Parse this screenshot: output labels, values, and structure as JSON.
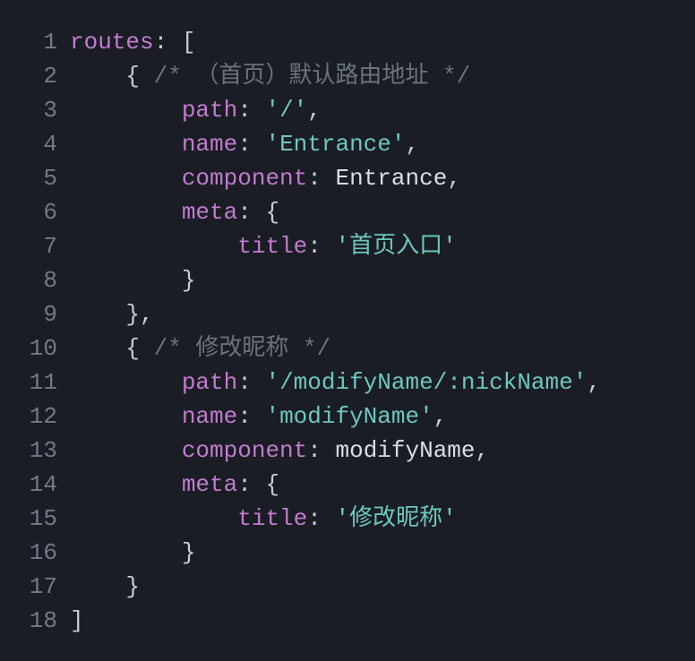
{
  "lines": [
    {
      "num": "1",
      "tokens": [
        {
          "cls": "t-key",
          "text": "routes"
        },
        {
          "cls": "t-plain",
          "text": ": ["
        }
      ]
    },
    {
      "num": "2",
      "tokens": [
        {
          "cls": "t-plain",
          "text": "    { "
        },
        {
          "cls": "t-comment",
          "text": "/* （首页）默认路由地址 */"
        }
      ]
    },
    {
      "num": "3",
      "tokens": [
        {
          "cls": "t-plain",
          "text": "        "
        },
        {
          "cls": "t-key",
          "text": "path"
        },
        {
          "cls": "t-plain",
          "text": ": "
        },
        {
          "cls": "t-string",
          "text": "'/'"
        },
        {
          "cls": "t-plain",
          "text": ","
        }
      ]
    },
    {
      "num": "4",
      "tokens": [
        {
          "cls": "t-plain",
          "text": "        "
        },
        {
          "cls": "t-key",
          "text": "name"
        },
        {
          "cls": "t-plain",
          "text": ": "
        },
        {
          "cls": "t-string",
          "text": "'Entrance'"
        },
        {
          "cls": "t-plain",
          "text": ","
        }
      ]
    },
    {
      "num": "5",
      "tokens": [
        {
          "cls": "t-plain",
          "text": "        "
        },
        {
          "cls": "t-key",
          "text": "component"
        },
        {
          "cls": "t-plain",
          "text": ": "
        },
        {
          "cls": "t-ident",
          "text": "Entrance"
        },
        {
          "cls": "t-plain",
          "text": ","
        }
      ]
    },
    {
      "num": "6",
      "tokens": [
        {
          "cls": "t-plain",
          "text": "        "
        },
        {
          "cls": "t-key",
          "text": "meta"
        },
        {
          "cls": "t-plain",
          "text": ": {"
        }
      ]
    },
    {
      "num": "7",
      "tokens": [
        {
          "cls": "t-plain",
          "text": "            "
        },
        {
          "cls": "t-key",
          "text": "title"
        },
        {
          "cls": "t-plain",
          "text": ": "
        },
        {
          "cls": "t-string",
          "text": "'首页入口'"
        }
      ]
    },
    {
      "num": "8",
      "tokens": [
        {
          "cls": "t-plain",
          "text": "        }"
        }
      ]
    },
    {
      "num": "9",
      "tokens": [
        {
          "cls": "t-plain",
          "text": "    },"
        }
      ]
    },
    {
      "num": "10",
      "tokens": [
        {
          "cls": "t-plain",
          "text": "    { "
        },
        {
          "cls": "t-comment",
          "text": "/* 修改昵称 */"
        }
      ]
    },
    {
      "num": "11",
      "tokens": [
        {
          "cls": "t-plain",
          "text": "        "
        },
        {
          "cls": "t-key",
          "text": "path"
        },
        {
          "cls": "t-plain",
          "text": ": "
        },
        {
          "cls": "t-string",
          "text": "'/modifyName/:nickName'"
        },
        {
          "cls": "t-plain",
          "text": ","
        }
      ]
    },
    {
      "num": "12",
      "tokens": [
        {
          "cls": "t-plain",
          "text": "        "
        },
        {
          "cls": "t-key",
          "text": "name"
        },
        {
          "cls": "t-plain",
          "text": ": "
        },
        {
          "cls": "t-string",
          "text": "'modifyName'"
        },
        {
          "cls": "t-plain",
          "text": ","
        }
      ]
    },
    {
      "num": "13",
      "tokens": [
        {
          "cls": "t-plain",
          "text": "        "
        },
        {
          "cls": "t-key",
          "text": "component"
        },
        {
          "cls": "t-plain",
          "text": ": "
        },
        {
          "cls": "t-ident",
          "text": "modifyName"
        },
        {
          "cls": "t-plain",
          "text": ","
        }
      ]
    },
    {
      "num": "14",
      "tokens": [
        {
          "cls": "t-plain",
          "text": "        "
        },
        {
          "cls": "t-key",
          "text": "meta"
        },
        {
          "cls": "t-plain",
          "text": ": {"
        }
      ]
    },
    {
      "num": "15",
      "tokens": [
        {
          "cls": "t-plain",
          "text": "            "
        },
        {
          "cls": "t-key",
          "text": "title"
        },
        {
          "cls": "t-plain",
          "text": ": "
        },
        {
          "cls": "t-string",
          "text": "'修改昵称'"
        }
      ]
    },
    {
      "num": "16",
      "tokens": [
        {
          "cls": "t-plain",
          "text": "        }"
        }
      ]
    },
    {
      "num": "17",
      "tokens": [
        {
          "cls": "t-plain",
          "text": "    }"
        }
      ]
    },
    {
      "num": "18",
      "tokens": [
        {
          "cls": "t-plain",
          "text": "]"
        }
      ]
    }
  ]
}
